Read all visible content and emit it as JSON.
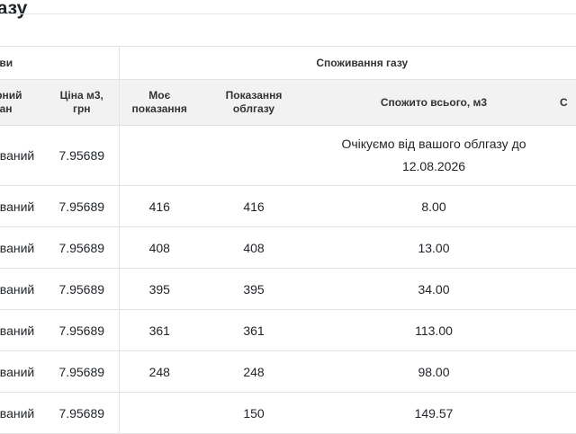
{
  "section": {
    "title": "газу"
  },
  "table": {
    "group_headers": {
      "conditions": "ови",
      "consumption": "Споживання газу"
    },
    "columns": {
      "plan": "фний\nлан",
      "price": "Ціна м3,\nгрн",
      "my_reading": "Моє\nпоказання",
      "meter_reading": "Показання\nоблгазу",
      "consumed_total": "Спожито всього, м3",
      "extra": "С"
    },
    "rows": [
      {
        "plan": "ований",
        "price": "7.95689",
        "my_reading": "",
        "meter_reading": "",
        "consumed": "",
        "note": "Очікуємо від вашого облгазу до 12.08.2026"
      },
      {
        "plan": "ований",
        "price": "7.95689",
        "my_reading": "416",
        "meter_reading": "416",
        "consumed": "8.00"
      },
      {
        "plan": "ований",
        "price": "7.95689",
        "my_reading": "408",
        "meter_reading": "408",
        "consumed": "13.00"
      },
      {
        "plan": "ований",
        "price": "7.95689",
        "my_reading": "395",
        "meter_reading": "395",
        "consumed": "34.00"
      },
      {
        "plan": "ований",
        "price": "7.95689",
        "my_reading": "361",
        "meter_reading": "361",
        "consumed": "113.00"
      },
      {
        "plan": "ований",
        "price": "7.95689",
        "my_reading": "248",
        "meter_reading": "248",
        "consumed": "98.00"
      },
      {
        "plan": "ований",
        "price": "7.95689",
        "my_reading": "",
        "meter_reading": "150",
        "consumed": "149.57"
      }
    ]
  }
}
